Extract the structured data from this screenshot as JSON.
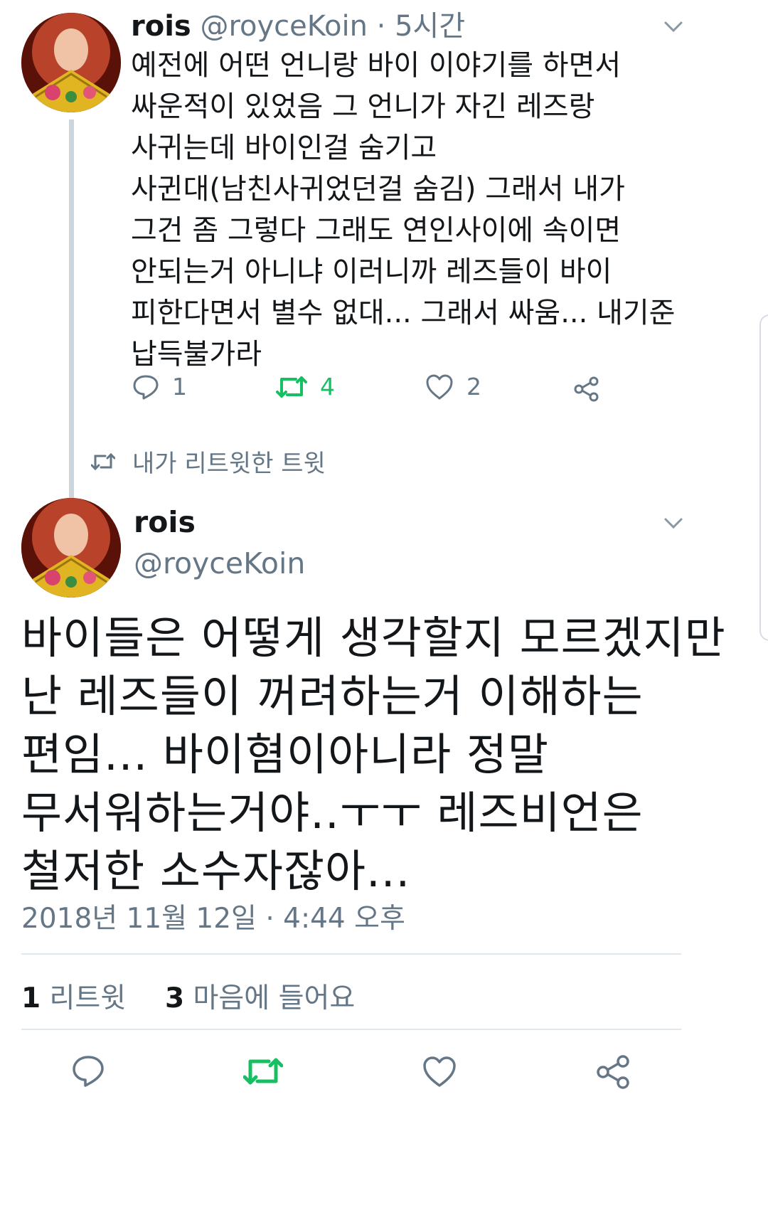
{
  "colors": {
    "text": "#14171a",
    "muted": "#657786",
    "retweet": "#17bf63",
    "divider": "#e1e8ed"
  },
  "parent_tweet": {
    "display_name": "rois",
    "handle": "@royceKoin",
    "separator": "·",
    "time": "5시간",
    "lines": [
      "예전에 어떤 언니랑 바이 이야기를 하면서",
      "싸운적이 있었음 그 언니가 자긴 레즈랑",
      "사귀는데 바이인걸 숨기고",
      "사귄대(남친사귀었던걸 숨김) 그래서 내가",
      "그건 좀 그렇다 그래도 연인사이에 속이면",
      "안되는거 아니냐 이러니까 레즈들이 바이",
      "피한다면서 별수 없대... 그래서 싸움... 내기준",
      "납득불가라"
    ],
    "actions": {
      "reply_count": "1",
      "retweet_count": "4",
      "like_count": "2"
    },
    "retweeted_label": "내가 리트윗한 트윗"
  },
  "main_tweet": {
    "display_name": "rois",
    "handle": "@royceKoin",
    "lines": [
      "바이들은 어떻게 생각할지 모르겠지만",
      "난 레즈들이 꺼려하는거 이해하는",
      "편임... 바이혐이아니라 정말",
      "무서워하는거야..ㅜㅜ 레즈비언은",
      "철저한 소수자잖아..."
    ],
    "timestamp": "2018년 11월 12일 · 4:44 오후",
    "stats": {
      "retweets_count": "1",
      "retweets_label": "리트윗",
      "likes_count": "3",
      "likes_label": "마음에 들어요"
    }
  },
  "icons": [
    "chevron-down-icon",
    "reply-icon",
    "retweet-icon",
    "heart-icon",
    "share-icon"
  ]
}
